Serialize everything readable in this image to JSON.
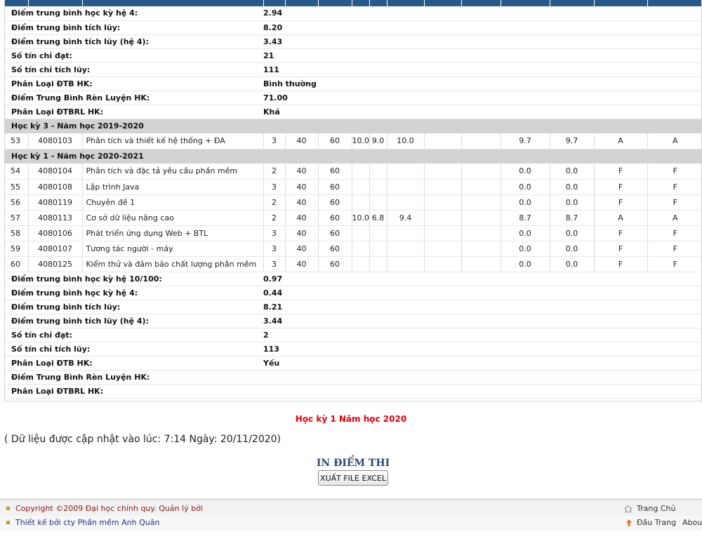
{
  "semester_block_a_summary": [
    {
      "label": "Điểm trung bình học kỳ hệ 4:",
      "value": "2.94"
    },
    {
      "label": "Điểm trung bình tích lũy:",
      "value": "8.20"
    },
    {
      "label": "Điểm trung bình tích lũy (hệ 4):",
      "value": "3.43"
    },
    {
      "label": "Số tín chỉ đạt:",
      "value": "21"
    },
    {
      "label": "Số tín chỉ tích lũy:",
      "value": "111"
    },
    {
      "label": "Phân Loại ĐTB HK:",
      "value": "Bình thường"
    },
    {
      "label": "Điểm Trung Bình Rèn Luyện HK:",
      "value": "71.00"
    },
    {
      "label": "Phân Loại ĐTBRL HK:",
      "value": "Khá"
    }
  ],
  "semester_3": {
    "title": "Học kỳ 3 - Năm học 2019-2020",
    "courses": [
      [
        "53",
        "4080103",
        "Phân tích và thiết kế hệ thống + ĐA",
        "3",
        "40",
        "60",
        "10.0",
        "9.0",
        "10.0",
        "",
        "",
        "9.7",
        "9.7",
        "A",
        "A"
      ]
    ]
  },
  "semester_1": {
    "title": "Học kỳ 1 - Năm học 2020-2021",
    "courses": [
      [
        "54",
        "4080104",
        "Phân tích và đặc tả yêu cầu phần mềm",
        "2",
        "40",
        "60",
        "",
        "",
        "",
        "",
        "",
        "0.0",
        "0.0",
        "F",
        "F"
      ],
      [
        "55",
        "4080108",
        "Lập trình Java",
        "3",
        "40",
        "60",
        "",
        "",
        "",
        "",
        "",
        "0.0",
        "0.0",
        "F",
        "F"
      ],
      [
        "56",
        "4080119",
        "Chuyên đề 1",
        "2",
        "40",
        "60",
        "",
        "",
        "",
        "",
        "",
        "0.0",
        "0.0",
        "F",
        "F"
      ],
      [
        "57",
        "4080113",
        "Cơ sở dữ liệu nâng cao",
        "2",
        "40",
        "60",
        "10.0",
        "6.8",
        "9.4",
        "",
        "",
        "8.7",
        "8.7",
        "A",
        "A"
      ],
      [
        "58",
        "4080106",
        "Phát triển ứng dụng Web + BTL",
        "3",
        "40",
        "60",
        "",
        "",
        "",
        "",
        "",
        "0.0",
        "0.0",
        "F",
        "F"
      ],
      [
        "59",
        "4080107",
        "Tương tác người - máy",
        "3",
        "40",
        "60",
        "",
        "",
        "",
        "",
        "",
        "0.0",
        "0.0",
        "F",
        "F"
      ],
      [
        "60",
        "4080125",
        "Kiểm thử và đảm bảo chất lượng phần mềm",
        "3",
        "40",
        "60",
        "",
        "",
        "",
        "",
        "",
        "0.0",
        "0.0",
        "F",
        "F"
      ]
    ]
  },
  "semester_block_b_summary": [
    {
      "label": "Điểm trung bình học kỳ hệ 10/100:",
      "value": "0.97"
    },
    {
      "label": "Điểm trung bình học kỳ hệ 4:",
      "value": "0.44"
    },
    {
      "label": "Điểm trung bình tích lũy:",
      "value": "8.21"
    },
    {
      "label": "Điểm trung bình tích lũy (hệ 4):",
      "value": "3.44"
    },
    {
      "label": "Số tín chỉ đạt:",
      "value": "2"
    },
    {
      "label": "Số tín chỉ tích lũy:",
      "value": "113"
    },
    {
      "label": "Phân Loại ĐTB HK:",
      "value": "Yếu"
    },
    {
      "label": "Điểm Trung Bình Rèn Luyện HK:",
      "value": ""
    },
    {
      "label": "Phân Loại ĐTBRL HK:",
      "value": ""
    }
  ],
  "selected_semester_note": "Học kỳ 1 Năm học 2020",
  "update_info": "( Dữ liệu được cập nhật vào lúc: 7:14 Ngày: 20/11/2020)",
  "print_title": "IN ĐIỂM THI",
  "excel_button": "XUẤT FILE EXCEL",
  "footer": {
    "copyright": "Copyright ©2009 Đại học chính quy. Quản lý bởi",
    "designer": "Thiết kế bởi cty Phần mềm Anh Quân",
    "home_link": "Trang Chủ",
    "top_link": "Đầu Trang",
    "about_link": "About"
  },
  "colors": {
    "header_bar": "#28598b",
    "semester_row_bg": "#d3d3d3",
    "note_red": "#e8000b",
    "print_title": "#2c4a72"
  },
  "icons": [
    "home-icon",
    "arrow-up-icon",
    "bullet-icon"
  ]
}
